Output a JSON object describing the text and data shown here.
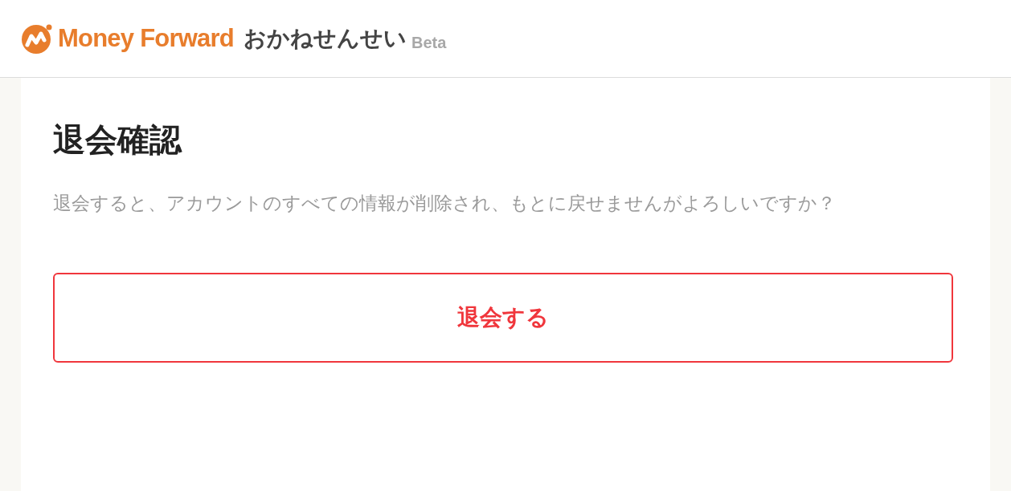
{
  "header": {
    "brand": "Money Forward",
    "product": "おかねせんせい",
    "badge": "Beta"
  },
  "card": {
    "title": "退会確認",
    "message": "退会すると、アカウントのすべての情報が削除され、もとに戻せませんがよろしいですか？",
    "button": "退会する"
  }
}
